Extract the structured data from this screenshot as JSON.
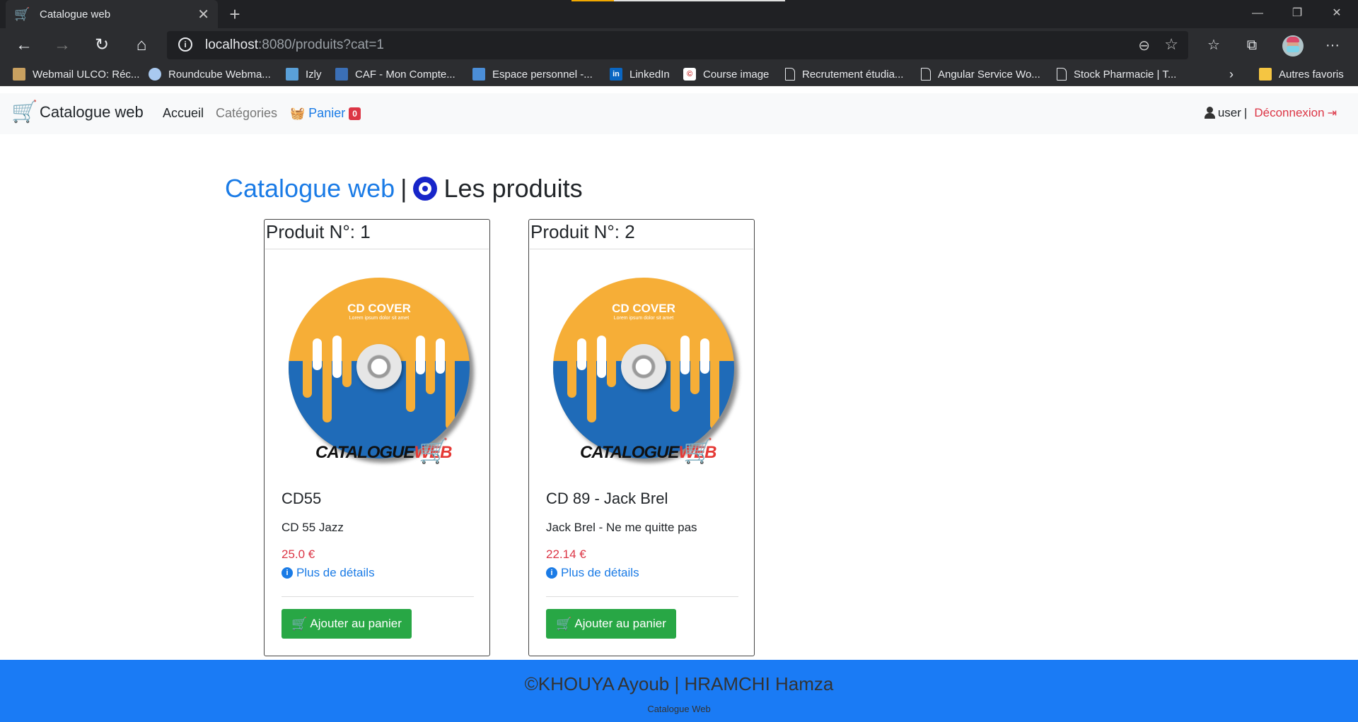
{
  "browser": {
    "tab_title": "Catalogue web",
    "url_host": "localhost",
    "url_rest": ":8080/produits?cat=1",
    "bookmarks": [
      {
        "label": "Webmail ULCO: Réc...",
        "icon": "ulco-icon"
      },
      {
        "label": "Roundcube Webma...",
        "icon": "roundcube-icon"
      },
      {
        "label": "Izly",
        "icon": "izly-icon"
      },
      {
        "label": "CAF - Mon Compte...",
        "icon": "caf-icon"
      },
      {
        "label": "Espace personnel -...",
        "icon": "espace-icon"
      },
      {
        "label": "LinkedIn",
        "icon": "linkedin-icon"
      },
      {
        "label": "Course image",
        "icon": "course-icon"
      },
      {
        "label": "Recrutement étudia...",
        "icon": "page-icon"
      },
      {
        "label": "Angular Service Wo...",
        "icon": "page-icon"
      },
      {
        "label": "Stock Pharmacie | T...",
        "icon": "page-icon"
      }
    ],
    "other_favorites": "Autres favoris"
  },
  "navbar": {
    "brand": "Catalogue web",
    "home": "Accueil",
    "categories": "Catégories",
    "cart": "Panier",
    "cart_count": "0",
    "user": "user",
    "user_sep": "|",
    "logout": "Déconnexion"
  },
  "page": {
    "brand_word": "Catalogue web",
    "pipe": "|",
    "title": "Les produits"
  },
  "products": [
    {
      "header": "Produit N°: 1",
      "name": "CD55",
      "description": "CD 55 Jazz",
      "price": "25.0 €",
      "details": "Plus de détails",
      "add_to_cart": "Ajouter au panier",
      "cover_title": "CD COVER",
      "cover_sub": "Lorem ipsum dolor sit amet",
      "logo_black": "CATALOGUE",
      "logo_red": "WEB"
    },
    {
      "header": "Produit N°: 2",
      "name": "CD 89 - Jack Brel",
      "description": "Jack Brel - Ne me quitte pas",
      "price": "22.14 €",
      "details": "Plus de détails",
      "add_to_cart": "Ajouter au panier",
      "cover_title": "CD COVER",
      "cover_sub": "Lorem ipsum dolor sit amet",
      "logo_black": "CATALOGUE",
      "logo_red": "WEB"
    }
  ],
  "footer": {
    "credits": "©KHOUYA Ayoub | HRAMCHI Hamza",
    "subtitle": "Catalogue Web"
  },
  "colors": {
    "primary": "#1a7be6",
    "danger": "#dc3545",
    "success": "#28a745",
    "footer_bg": "#1a7bf5"
  }
}
